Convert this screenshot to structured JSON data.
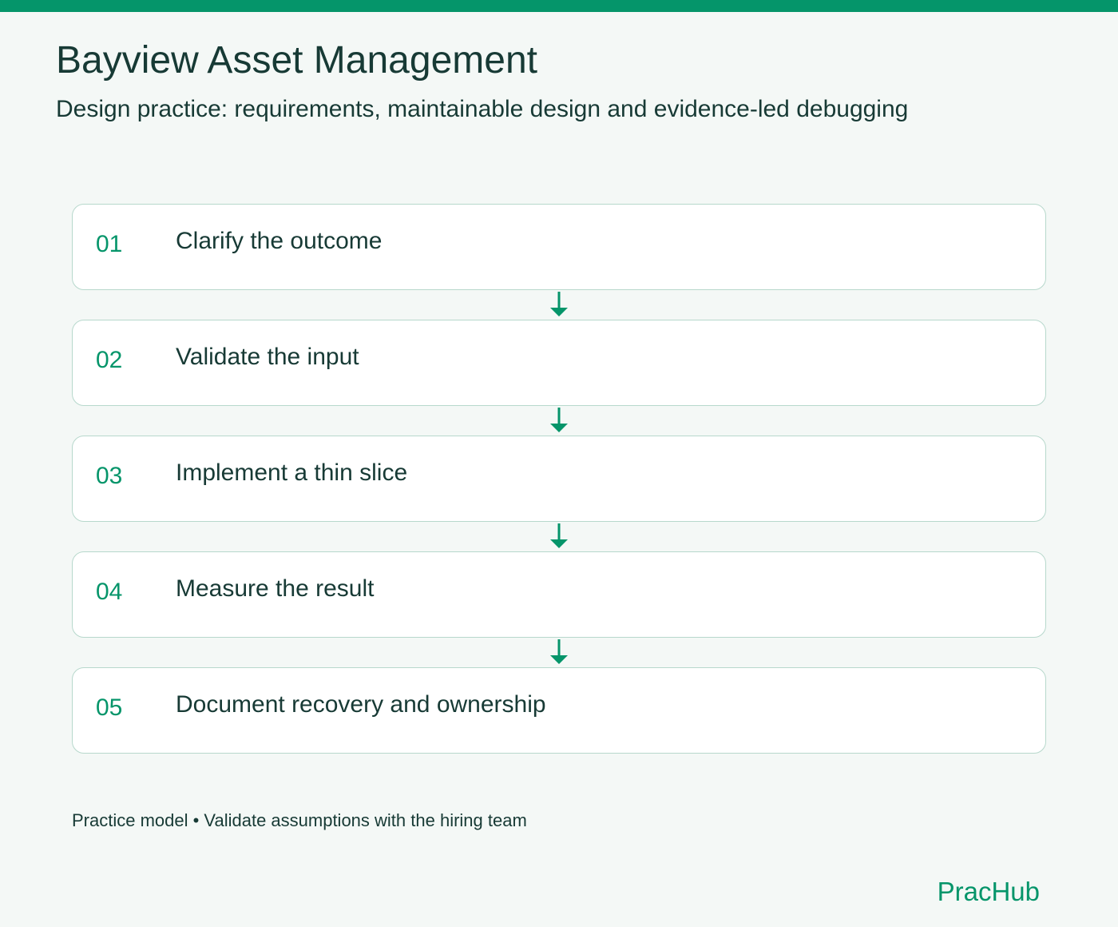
{
  "header": {
    "title": "Bayview Asset Management",
    "subtitle": "Design practice: requirements, maintainable design and evidence-led debugging"
  },
  "steps": [
    {
      "number": "01",
      "label": "Clarify the outcome"
    },
    {
      "number": "02",
      "label": "Validate the input"
    },
    {
      "number": "03",
      "label": "Implement a thin slice"
    },
    {
      "number": "04",
      "label": "Measure the result"
    },
    {
      "number": "05",
      "label": "Document recovery and ownership"
    }
  ],
  "footer": {
    "note": "Practice model • Validate assumptions with the hiring team",
    "brand": "PracHub"
  },
  "colors": {
    "accent": "#05956a",
    "text": "#173a35",
    "background": "#f4f8f6",
    "card_border": "#b7d8cc",
    "card_background": "#ffffff"
  },
  "icons": {
    "connector": "arrow-down-icon"
  }
}
